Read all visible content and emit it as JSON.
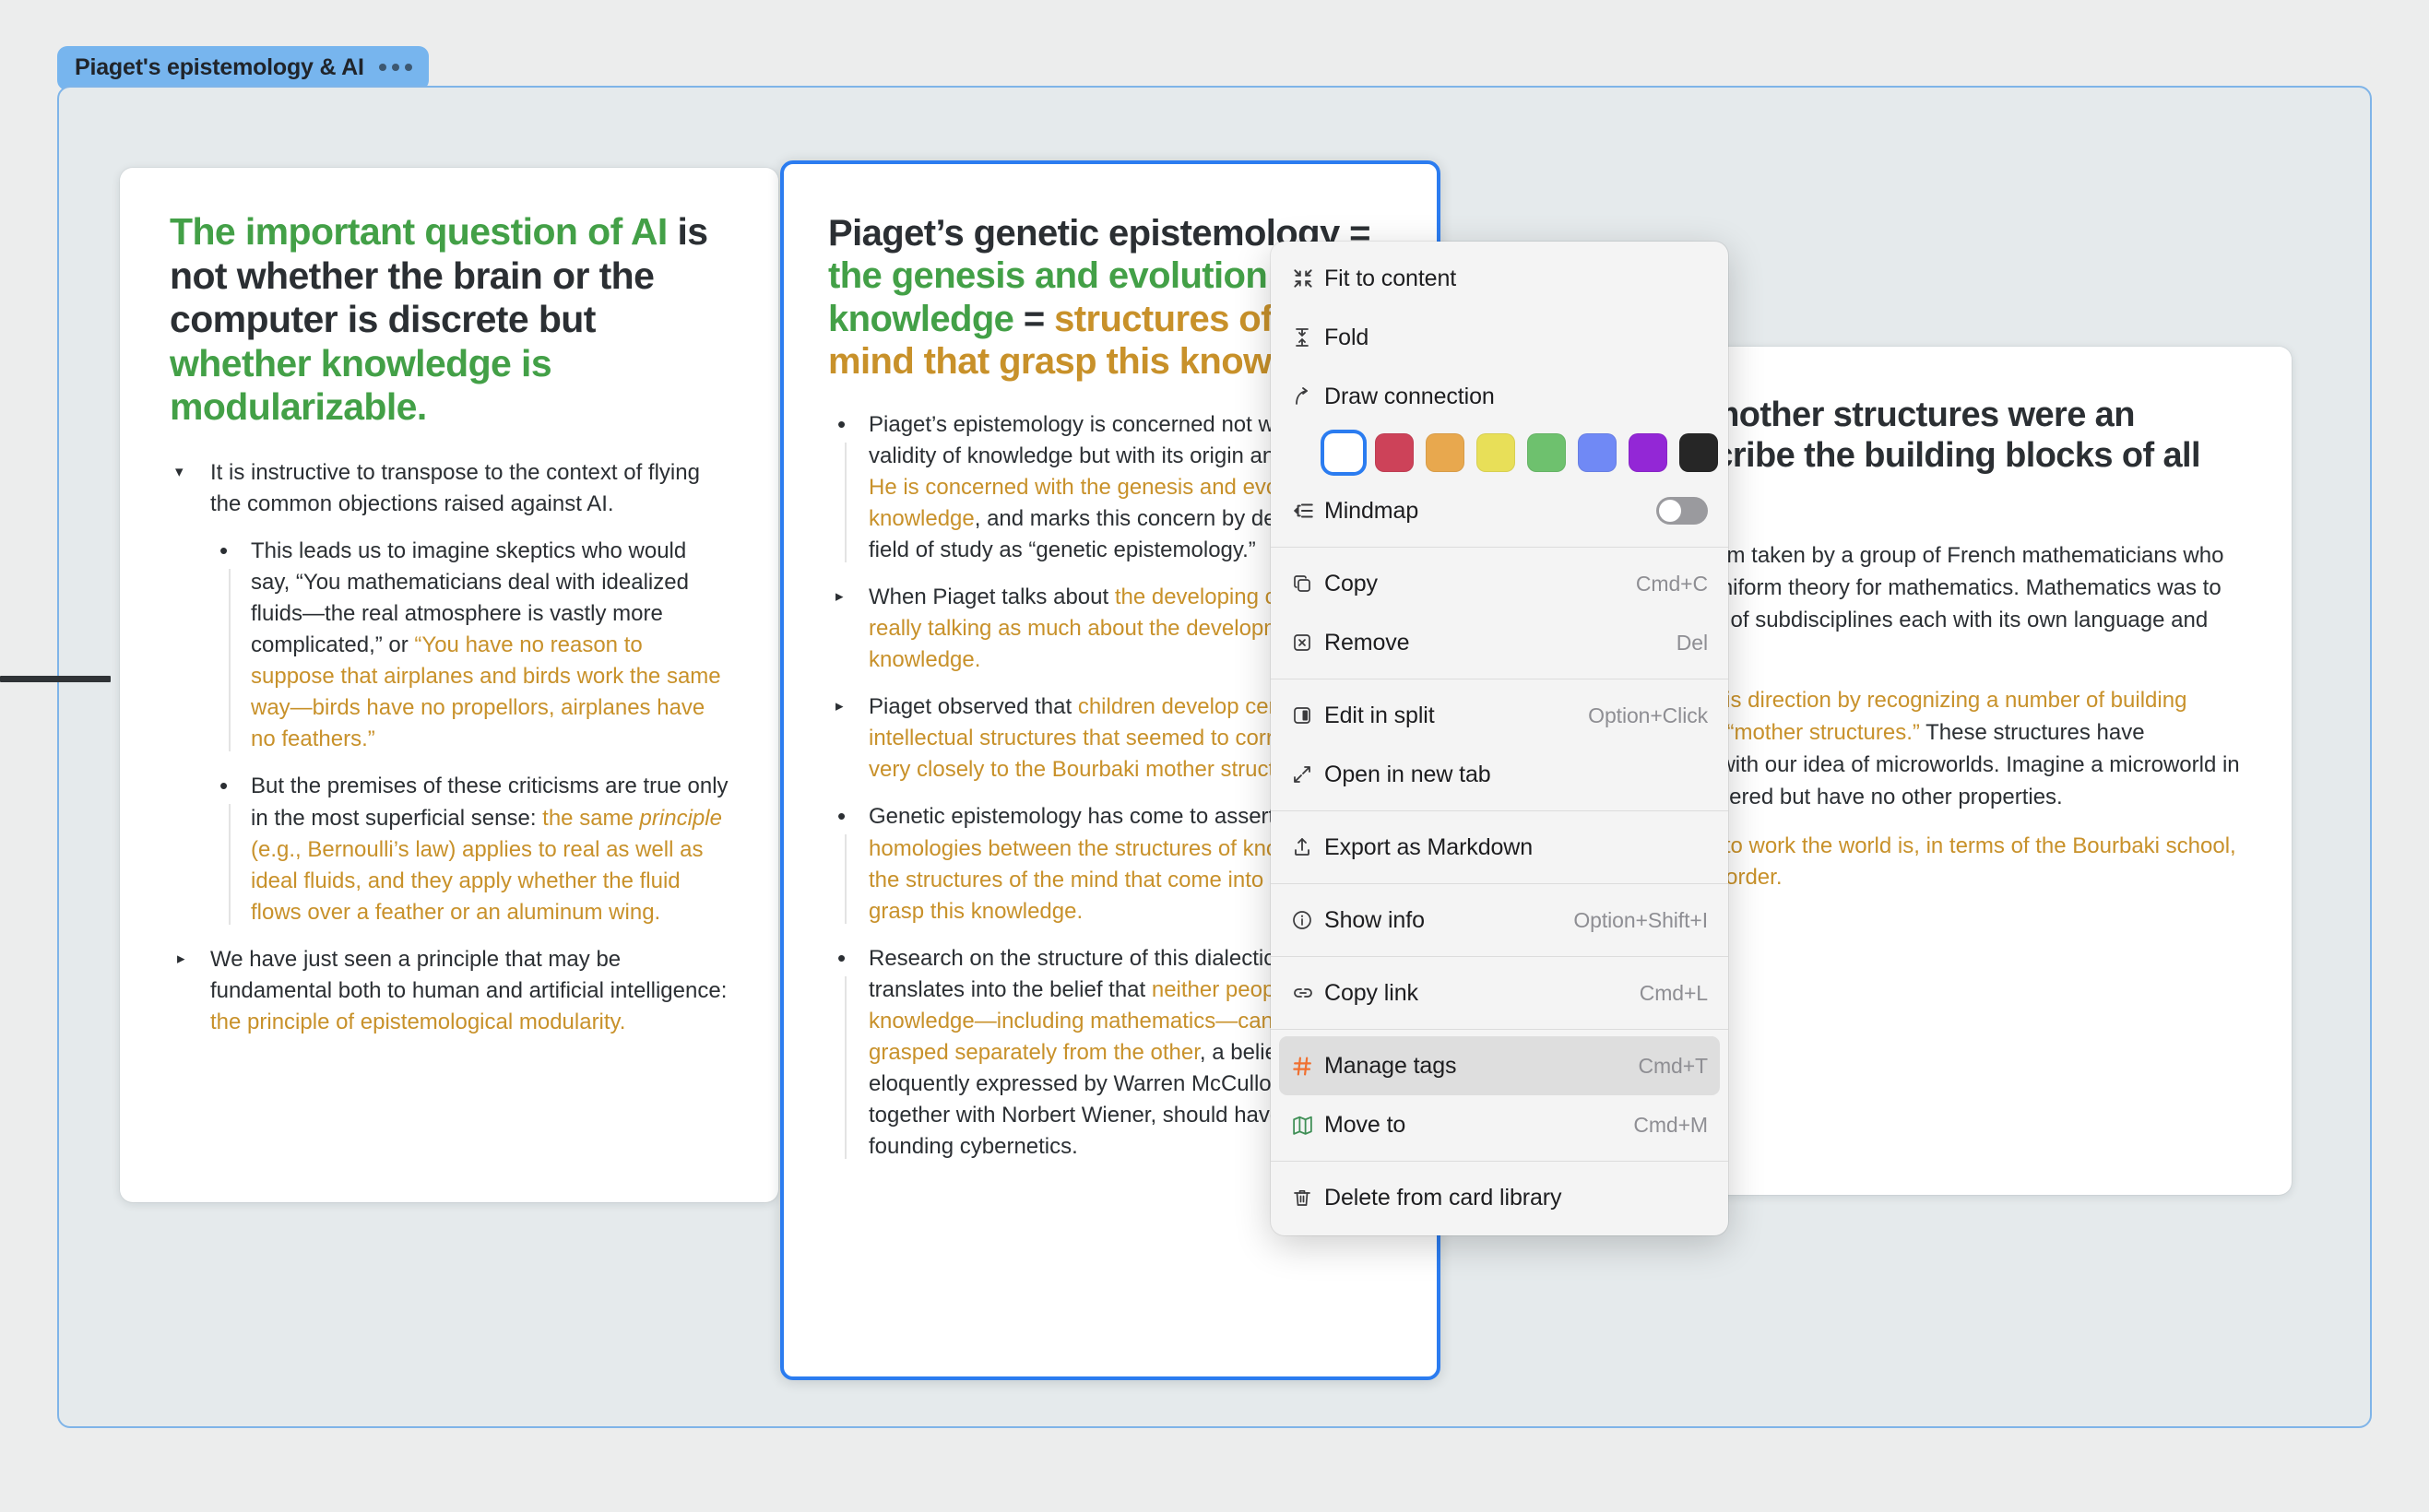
{
  "tab": {
    "label": "Piaget's epistemology & AI",
    "overflow_icon": "more-horizontal-icon"
  },
  "colors": {
    "green": "#43a047",
    "orange": "#c8912a",
    "selection_blue": "#2b7cf0",
    "tab_blue": "#77b5ee",
    "canvas": "#e5eaec"
  },
  "cards": [
    {
      "title_parts": [
        {
          "text": "The important question of AI ",
          "style": "green"
        },
        {
          "text": "is not whether the brain or the computer is discrete but ",
          "style": "plain"
        },
        {
          "text": "whether knowledge is modularizable.",
          "style": "green"
        }
      ],
      "bullets": [
        {
          "marker": "triangle-down",
          "level": 1,
          "parts": [
            {
              "text": "It is instructive to transpose to the context of flying the common objections raised against AI.",
              "style": "plain"
            }
          ]
        },
        {
          "marker": "dot",
          "level": 2,
          "parts": [
            {
              "text": "This leads us to imagine skeptics who would say, “You mathematicians deal with idealized fluids—the real atmosphere is vastly more complicated,” or ",
              "style": "plain"
            },
            {
              "text": "“You have no reason to suppose that airplanes and birds work the same way—birds have no propellors, airplanes have no feathers.”",
              "style": "orange"
            }
          ]
        },
        {
          "marker": "dot",
          "level": 2,
          "parts": [
            {
              "text": "But the premises of these criticisms are true only in the most superficial sense: ",
              "style": "plain"
            },
            {
              "text": "the same ",
              "style": "orange"
            },
            {
              "text": "principle",
              "style": "orange-italic"
            },
            {
              "text": " (e.g., Bernoulli’s law) applies to real as well as ideal fluids, and they apply whether the fluid flows over a feather or an aluminum wing.",
              "style": "orange"
            }
          ]
        },
        {
          "marker": "triangle-right",
          "level": 1,
          "parts": [
            {
              "text": "We have just seen a principle that may be fundamental both to human and artificial intelligence: ",
              "style": "plain"
            },
            {
              "text": "the principle of epistemological modularity.",
              "style": "orange"
            }
          ]
        }
      ]
    },
    {
      "selected": true,
      "title_parts": [
        {
          "text": "Piaget’s genetic epistemology = ",
          "style": "plain"
        },
        {
          "text": "the genesis and evolution of knowledge ",
          "style": "green"
        },
        {
          "text": "= ",
          "style": "plain"
        },
        {
          "text": "structures of the mind that grasp this knowledge.",
          "style": "orange"
        }
      ],
      "bullets": [
        {
          "marker": "dot",
          "level": 1,
          "parts": [
            {
              "text": "Piaget’s epistemology is concerned not with the validity of knowledge but with its origin and growth. ",
              "style": "plain"
            },
            {
              "text": "He is concerned with the genesis and evolution of knowledge",
              "style": "orange"
            },
            {
              "text": ", and marks this concern by describing his field of study as “genetic epistemology.”",
              "style": "plain"
            }
          ]
        },
        {
          "marker": "triangle-right",
          "level": 1,
          "parts": [
            {
              "text": "When Piaget talks about ",
              "style": "plain"
            },
            {
              "text": "the developing child, he is really talking as much about the development of knowledge.",
              "style": "orange"
            }
          ]
        },
        {
          "marker": "triangle-right",
          "level": 1,
          "parts": [
            {
              "text": "Piaget observed that ",
              "style": "plain"
            },
            {
              "text": "children develop certain intellectual structures that seemed to correspond very closely to the Bourbaki mother structures.",
              "style": "orange"
            }
          ]
        },
        {
          "marker": "dot",
          "level": 1,
          "parts": [
            {
              "text": "Genetic epistemology has come to assert ",
              "style": "plain"
            },
            {
              "text": "homologies between the structures of knowledge and the structures of the mind that come into being to grasp this knowledge.",
              "style": "orange"
            }
          ]
        },
        {
          "marker": "dot",
          "level": 1,
          "parts": [
            {
              "text": "Research on the structure of this dialectical process translates into the belief that ",
              "style": "plain"
            },
            {
              "text": "neither people nor knowledge—including mathematics—can be fully grasped separately from the other",
              "style": "orange"
            },
            {
              "text": ", a belief that was eloquently expressed by Warren McCulloch, who, together with Norbert Wiener, should have credit for founding cybernetics.",
              "style": "plain"
            }
          ]
        }
      ]
    },
    {
      "title_parts": [
        {
          "text": "The Bourbaki mother structures were an attempt to describe the building blocks of all mathematics.",
          "style": "plain"
        }
      ],
      "paragraphs": [
        {
          "parts": [
            {
              "text": "Bourbaki is a pseudonym taken by a group of French mathematicians who set out to articulate a uniform theory for mathematics. Mathematics was to be one, not a collection of subdisciplines each with its own language and line of development.",
              "style": "plain"
            }
          ]
        },
        {
          "parts": [
            {
              "text": "The school moved in this direction by recognizing a number of building blocks that it called the “mother structures.”",
              "style": "orange"
            },
            {
              "text": " These structures have something in common with our idea of microworlds. Imagine a microworld in which things can be ordered but have no other properties.",
              "style": "plain"
            }
          ]
        },
        {
          "parts": [
            {
              "text": "The knowledge of how to work the world is, in terms of the Bourbaki school, the mother structure of order.",
              "style": "orange"
            }
          ]
        }
      ]
    }
  ],
  "context_menu": {
    "groups": [
      {
        "items": [
          {
            "icon": "fit-to-content-icon",
            "label": "Fit to content",
            "shortcut": ""
          },
          {
            "icon": "fold-icon",
            "label": "Fold",
            "shortcut": ""
          },
          {
            "icon": "draw-connection-icon",
            "label": "Draw connection",
            "shortcut": ""
          }
        ]
      },
      {
        "swatches": [
          {
            "name": "white",
            "hex": "#ffffff",
            "selected": true
          },
          {
            "name": "red",
            "hex": "#cd4259",
            "selected": false
          },
          {
            "name": "orange",
            "hex": "#e8a84e",
            "selected": false
          },
          {
            "name": "yellow",
            "hex": "#e8df58",
            "selected": false
          },
          {
            "name": "green",
            "hex": "#6ec16e",
            "selected": false
          },
          {
            "name": "blue",
            "hex": "#7089f5",
            "selected": false
          },
          {
            "name": "purple",
            "hex": "#9327d6",
            "selected": false
          },
          {
            "name": "black",
            "hex": "#262626",
            "selected": false
          }
        ]
      },
      {
        "items": [
          {
            "icon": "mindmap-icon",
            "label": "Mindmap",
            "shortcut": "",
            "toggle": false
          }
        ]
      },
      {
        "items": [
          {
            "icon": "copy-icon",
            "label": "Copy",
            "shortcut": "Cmd+C"
          },
          {
            "icon": "remove-icon",
            "label": "Remove",
            "shortcut": "Del"
          }
        ]
      },
      {
        "items": [
          {
            "icon": "edit-in-split-icon",
            "label": "Edit in split",
            "shortcut": "Option+Click"
          },
          {
            "icon": "open-in-new-tab-icon",
            "label": "Open in new tab",
            "shortcut": ""
          }
        ]
      },
      {
        "items": [
          {
            "icon": "export-icon",
            "label": "Export as Markdown",
            "shortcut": ""
          }
        ]
      },
      {
        "items": [
          {
            "icon": "info-icon",
            "label": "Show info",
            "shortcut": "Option+Shift+I"
          }
        ]
      },
      {
        "items": [
          {
            "icon": "link-icon",
            "label": "Copy link",
            "shortcut": "Cmd+L"
          }
        ]
      },
      {
        "items": [
          {
            "icon": "hash-icon",
            "label": "Manage tags",
            "shortcut": "Cmd+T",
            "highlighted": true
          },
          {
            "icon": "map-icon",
            "label": "Move to",
            "shortcut": "Cmd+M"
          }
        ]
      },
      {
        "items": [
          {
            "icon": "trash-icon",
            "label": "Delete from card library",
            "shortcut": ""
          }
        ]
      }
    ]
  }
}
